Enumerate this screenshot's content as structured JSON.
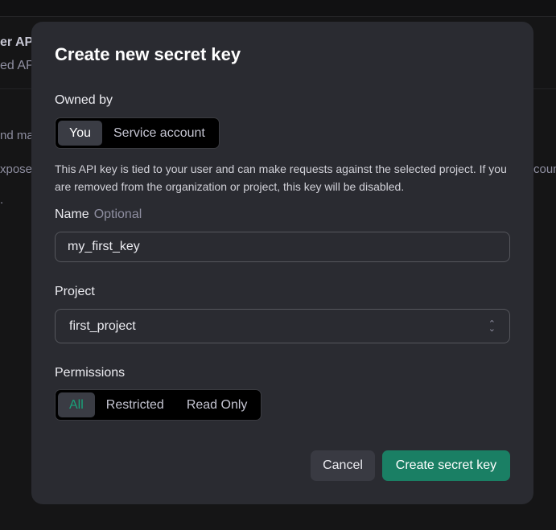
{
  "background": {
    "fragments": [
      "er AP",
      "ed AP",
      "nd ma",
      "xpose",
      "coun",
      "."
    ]
  },
  "modal": {
    "title": "Create new secret key",
    "owned_by": {
      "label": "Owned by",
      "options": [
        "You",
        "Service account"
      ],
      "selected": "You"
    },
    "description": "This API key is tied to your user and can make requests against the selected project. If you are removed from the organization or project, this key will be disabled.",
    "name": {
      "label": "Name",
      "hint": "Optional",
      "value": "my_first_key"
    },
    "project": {
      "label": "Project",
      "value": "first_project"
    },
    "permissions": {
      "label": "Permissions",
      "options": [
        "All",
        "Restricted",
        "Read Only"
      ],
      "selected": "All"
    },
    "cancel_label": "Cancel",
    "create_label": "Create secret key"
  },
  "colors": {
    "accent": "#1a7f64",
    "selected_text": "#19a27a"
  }
}
